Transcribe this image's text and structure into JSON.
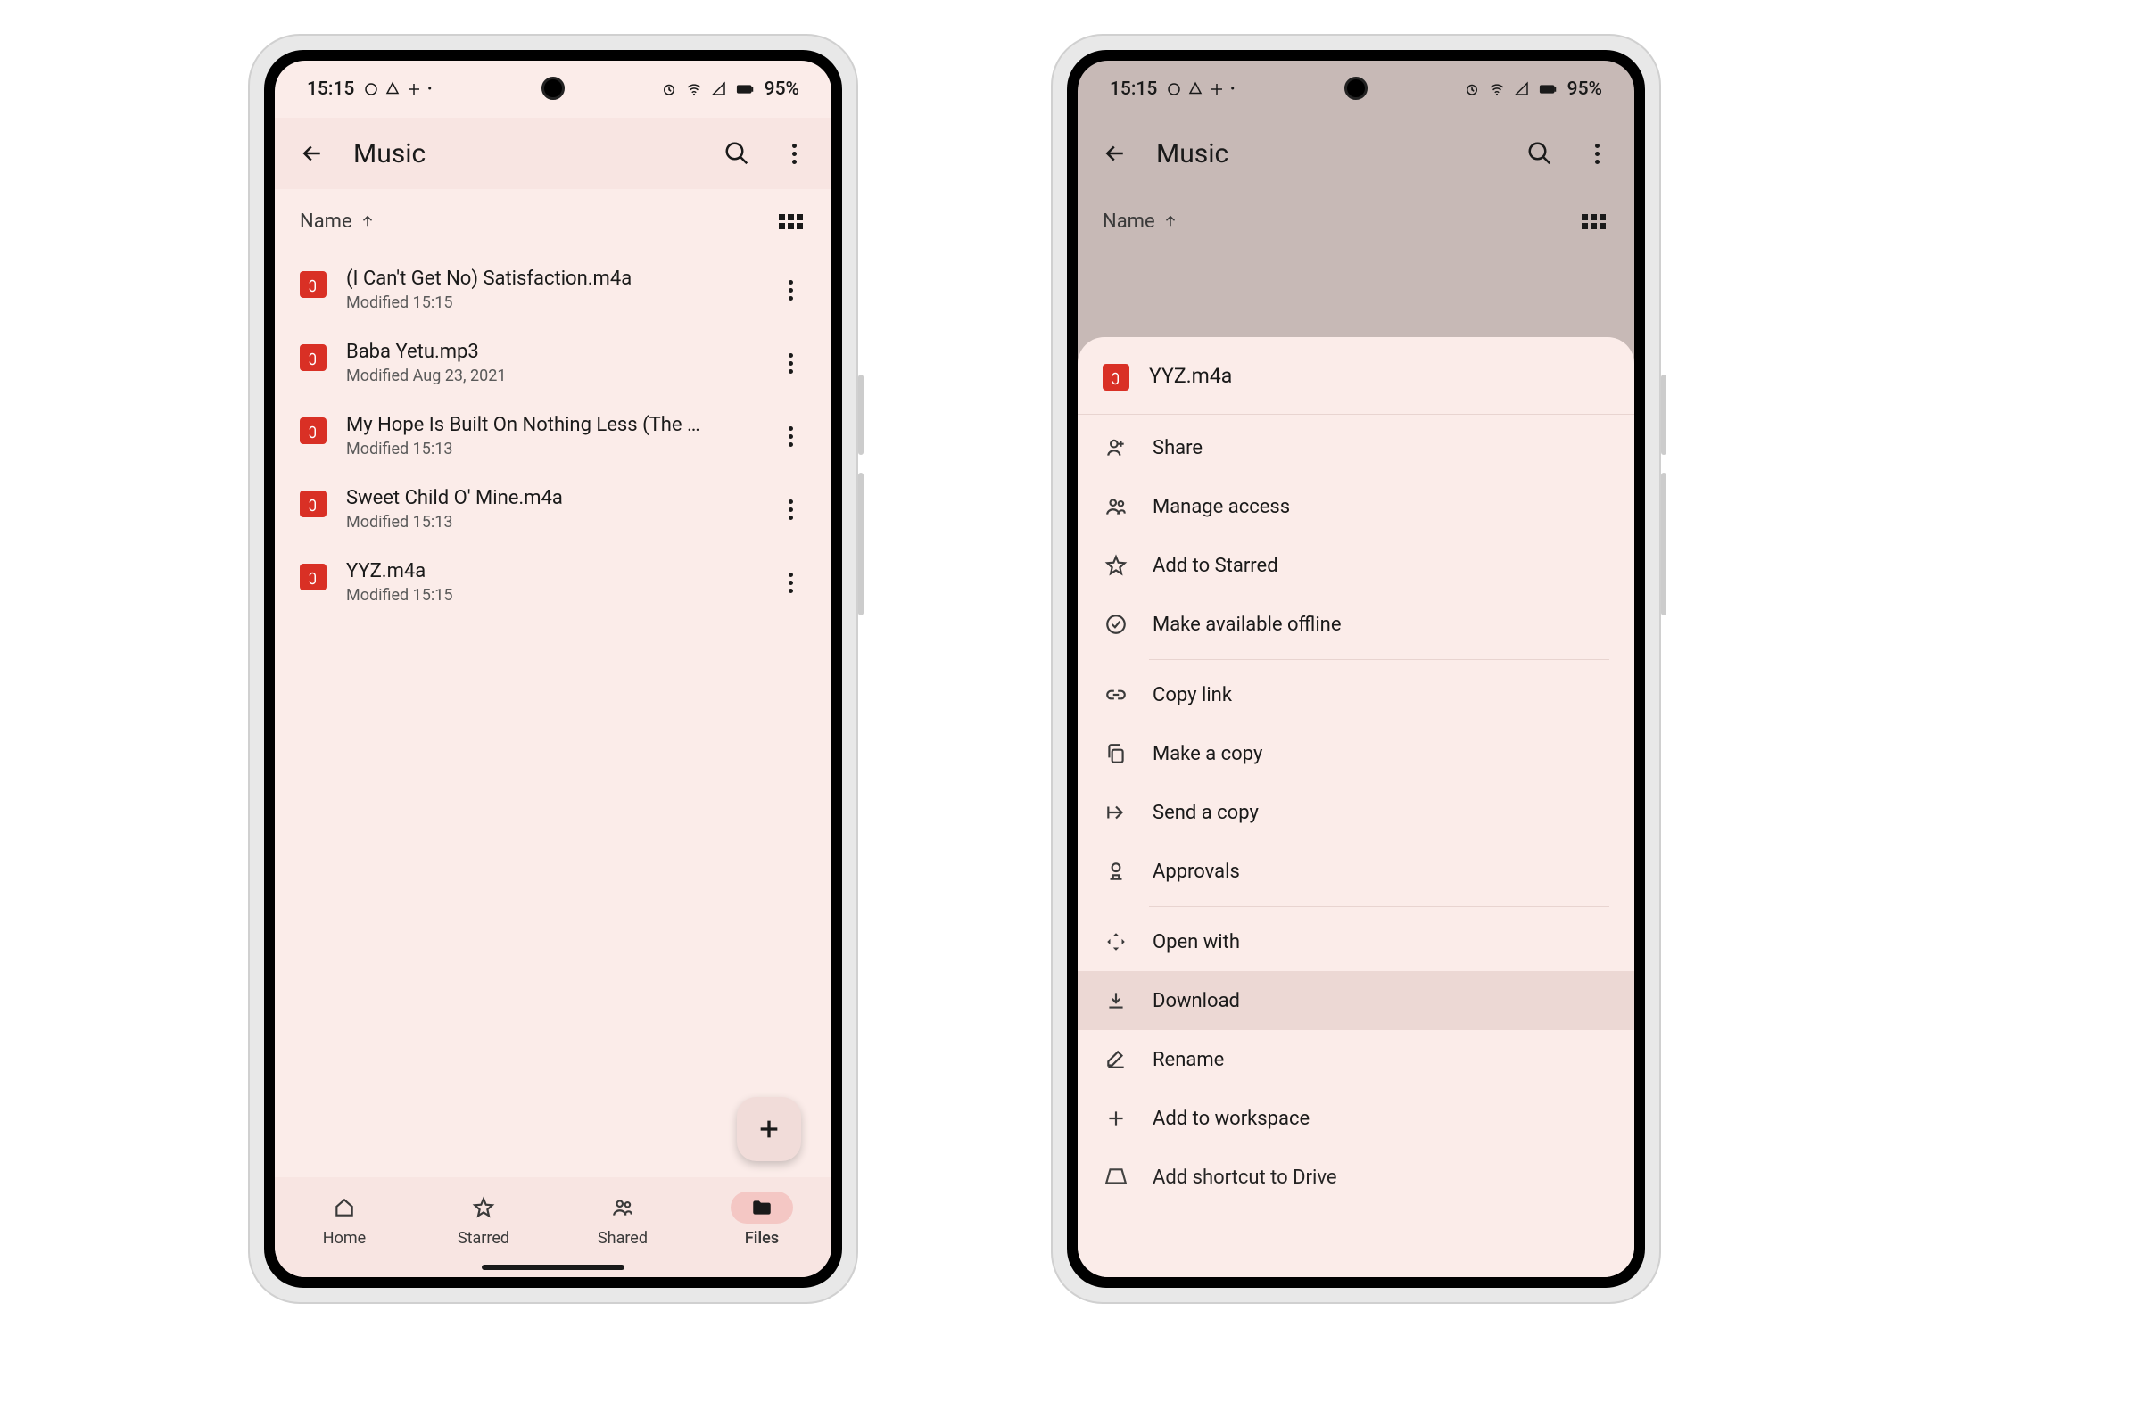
{
  "status": {
    "time": "15:15",
    "battery": "95%"
  },
  "appbar": {
    "title": "Music"
  },
  "sort": {
    "label": "Name"
  },
  "files": [
    {
      "name": "(I Can't Get No) Satisfaction.m4a",
      "meta": "Modified 15:15"
    },
    {
      "name": "Baba Yetu.mp3",
      "meta": "Modified Aug 23, 2021"
    },
    {
      "name": "My Hope Is Built On Nothing Less (The …",
      "meta": "Modified 15:13"
    },
    {
      "name": "Sweet Child O' Mine.m4a",
      "meta": "Modified 15:13"
    },
    {
      "name": "YYZ.m4a",
      "meta": "Modified 15:15"
    }
  ],
  "nav": {
    "home": "Home",
    "starred": "Starred",
    "shared": "Shared",
    "files": "Files"
  },
  "sheet": {
    "title": "YYZ.m4a",
    "items": {
      "share": "Share",
      "manage_access": "Manage access",
      "add_starred": "Add to Starred",
      "offline": "Make available offline",
      "copy_link": "Copy link",
      "make_copy": "Make a copy",
      "send_copy": "Send a copy",
      "approvals": "Approvals",
      "open_with": "Open with",
      "download": "Download",
      "rename": "Rename",
      "add_workspace": "Add to workspace",
      "add_shortcut": "Add shortcut to Drive"
    }
  }
}
